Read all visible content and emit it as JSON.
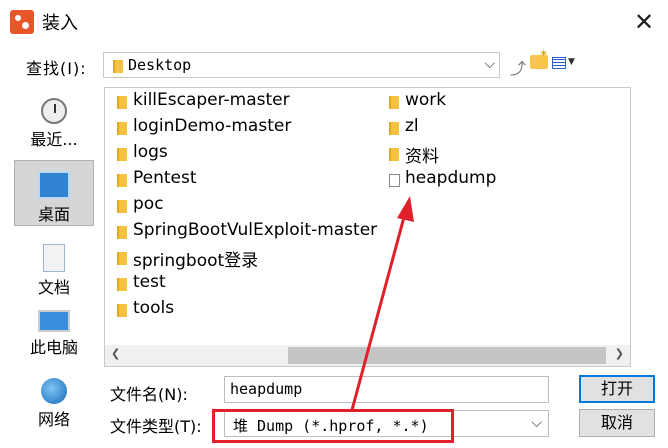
{
  "window": {
    "title": "装入",
    "close_glyph": "✕"
  },
  "lookin": {
    "label": "查找(I):",
    "value": "Desktop"
  },
  "places": [
    {
      "label": "最近..."
    },
    {
      "label": "桌面"
    },
    {
      "label": "文档"
    },
    {
      "label": "此电脑"
    },
    {
      "label": "网络"
    }
  ],
  "files_col1": [
    "killEscaper-master",
    "loginDemo-master",
    "logs",
    "Pentest",
    "poc",
    "SpringBootVulExploit-master",
    "springboot登录",
    "test",
    "tools"
  ],
  "files_col2": [
    "work",
    "zl",
    "资料",
    "heapdump"
  ],
  "filename": {
    "label": "文件名(N):",
    "value": "heapdump"
  },
  "filetype": {
    "label": "文件类型(T):",
    "value": "堆 Dump (*.hprof, *.*)"
  },
  "buttons": {
    "open": "打开",
    "cancel": "取消"
  },
  "annotation": {
    "color": "#e0202a"
  }
}
